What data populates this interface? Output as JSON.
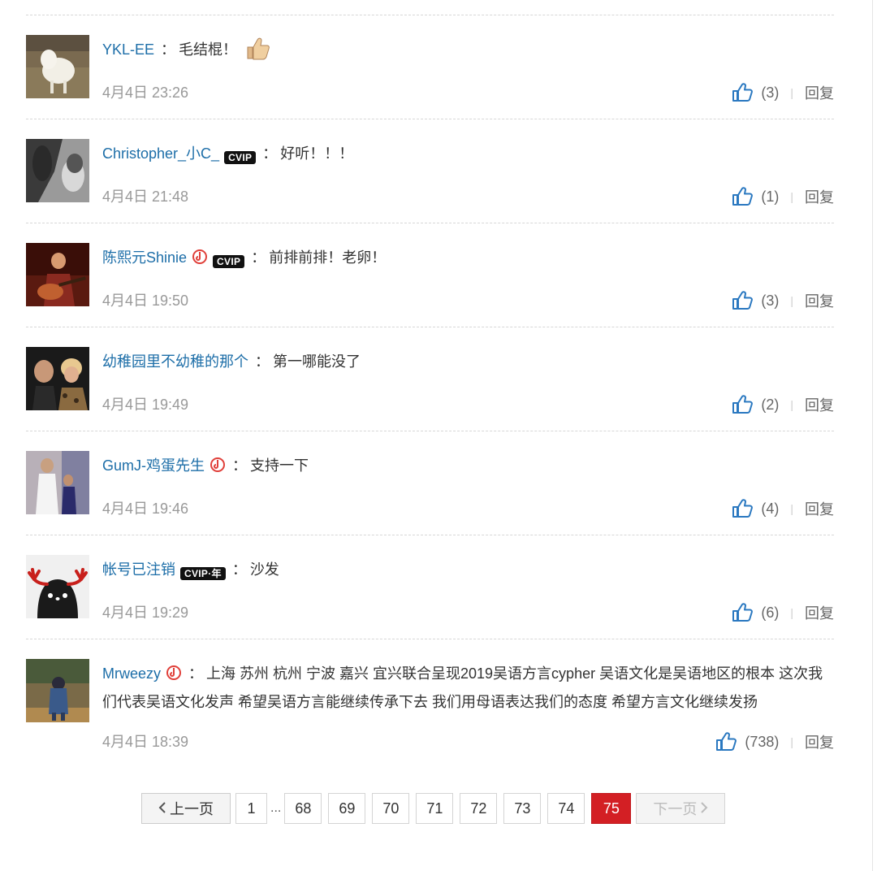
{
  "comments": [
    {
      "user": "YKL-EE",
      "text": "毛结棍！",
      "time": "4月4日 23:26",
      "likes": "(3)",
      "reply": "回复"
    },
    {
      "user": "Christopher_小C_",
      "vip": "CVIP",
      "text": "好听！！！",
      "time": "4月4日 21:48",
      "likes": "(1)",
      "reply": "回复"
    },
    {
      "user": "陈熙元Shinie",
      "vip": "CVIP",
      "text": "前排前排！老卵！",
      "time": "4月4日 19:50",
      "likes": "(3)",
      "reply": "回复"
    },
    {
      "user": "幼稚园里不幼稚的那个",
      "text": "第一哪能没了",
      "time": "4月4日 19:49",
      "likes": "(2)",
      "reply": "回复"
    },
    {
      "user": "GumJ-鸡蛋先生",
      "text": "支持一下",
      "time": "4月4日 19:46",
      "likes": "(4)",
      "reply": "回复"
    },
    {
      "user": "帐号已注销",
      "vip": "CVIP·年",
      "text": "沙发",
      "time": "4月4日 19:29",
      "likes": "(6)",
      "reply": "回复"
    },
    {
      "user": "Mrweezy",
      "text": "上海 苏州 杭州 宁波 嘉兴 宜兴联合呈现2019吴语方言cypher 吴语文化是吴语地区的根本 这次我们代表吴语文化发声 希望吴语方言能继续传承下去 我们用母语表达我们的态度 希望方言文化继续发扬",
      "time": "4月4日 18:39",
      "likes": "(738)",
      "reply": "回复"
    }
  ],
  "colon": "：",
  "pagination": {
    "prev": "上一页",
    "next": "下一页",
    "ellipsis": "...",
    "pages": [
      "1",
      "68",
      "69",
      "70",
      "71",
      "72",
      "73",
      "74",
      "75"
    ],
    "current": "75"
  },
  "colors": {
    "link": "#1d6ea8",
    "accent_red": "#d31f24",
    "like_icon": "#2a78c0",
    "meta": "#999999"
  },
  "icons": {
    "like": "thumbs-up-outline-icon",
    "music_badge": "music-badge-icon",
    "emoji": "thumbs-up-emoji"
  }
}
